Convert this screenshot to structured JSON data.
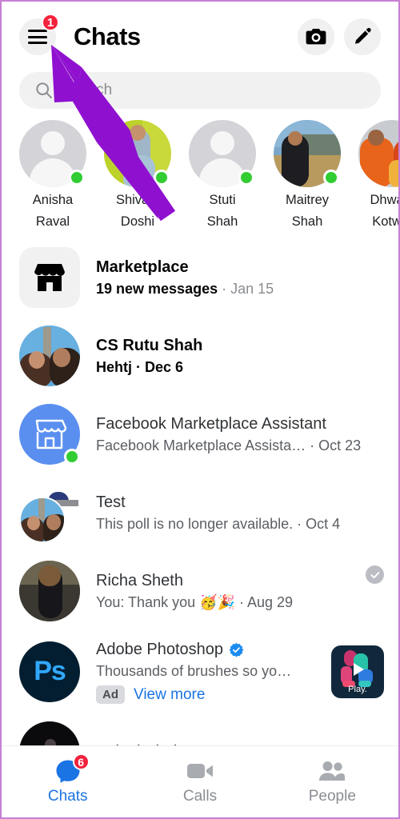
{
  "header": {
    "title": "Chats",
    "menu_badge": "1",
    "menu_icon": "hamburger-menu-icon",
    "camera_icon": "camera-icon",
    "compose_icon": "pencil-compose-icon"
  },
  "search": {
    "placeholder": "Search",
    "value": "",
    "icon": "search-icon"
  },
  "active_now": [
    {
      "name_line1": "Anisha",
      "name_line2": "Raval",
      "online": true,
      "avatar": "placeholder-person"
    },
    {
      "name_line1": "Shivani",
      "name_line2": "Doshi",
      "online": true,
      "avatar": "photo-woman-yellow"
    },
    {
      "name_line1": "Stuti",
      "name_line2": "Shah",
      "online": true,
      "avatar": "placeholder-person"
    },
    {
      "name_line1": "Maitrey",
      "name_line2": "Shah",
      "online": true,
      "avatar": "photo-mountain"
    },
    {
      "name_line1": "Dhwani",
      "name_line2": "Kotwal",
      "online": true,
      "avatar": "photo-couple-orange"
    }
  ],
  "chats": [
    {
      "name": "Marketplace",
      "unread": true,
      "preview": "19 new messages",
      "time": "Jan 15",
      "avatar_type": "marketplace-tile",
      "avatar_icon": "storefront-icon"
    },
    {
      "name": "CS Rutu Shah",
      "unread": true,
      "preview": "Hehtj",
      "time": "Dec 6",
      "avatar_type": "photo-couple-paris"
    },
    {
      "name": "Facebook Marketplace Assistant",
      "unread": false,
      "preview": "Facebook Marketplace Assista…",
      "time": "Oct 23",
      "avatar_type": "blue-storefront",
      "avatar_icon": "storefront-outline-icon",
      "online": true
    },
    {
      "name": "Test",
      "unread": false,
      "preview": "This poll is no longer available.",
      "time": "Oct 4",
      "avatar_type": "group-stack"
    },
    {
      "name": "Richa Sheth",
      "unread": false,
      "preview": "You: Thank you 🥳🎉",
      "time": "Aug 29",
      "avatar_type": "photo-woman-black-dress",
      "read_receipt": true,
      "read_receipt_icon": "check-circle-icon"
    },
    {
      "name": "Adobe Photoshop",
      "unread": false,
      "verified": true,
      "verified_icon": "verified-badge-icon",
      "preview": "Thousands of brushes so yo…",
      "ad_chip": "Ad",
      "ad_link": "View more",
      "avatar_type": "photoshop-logo",
      "avatar_text": "Ps",
      "thumb_label": "Play.",
      "thumb_icon": "play-triangle-icon"
    },
    {
      "name": "Saloni Shah",
      "unread": false,
      "preview": "",
      "time": "",
      "avatar_type": "photo-dark"
    }
  ],
  "bottom_nav": [
    {
      "label": "Chats",
      "icon": "chat-bubble-icon",
      "active": true,
      "badge": "6"
    },
    {
      "label": "Calls",
      "icon": "video-camera-icon",
      "active": false,
      "badge": ""
    },
    {
      "label": "People",
      "icon": "people-icon",
      "active": false,
      "badge": ""
    }
  ],
  "annotation": {
    "cursor_color": "#8f10cf",
    "cursor_icon": "arrow-cursor-annotation"
  }
}
